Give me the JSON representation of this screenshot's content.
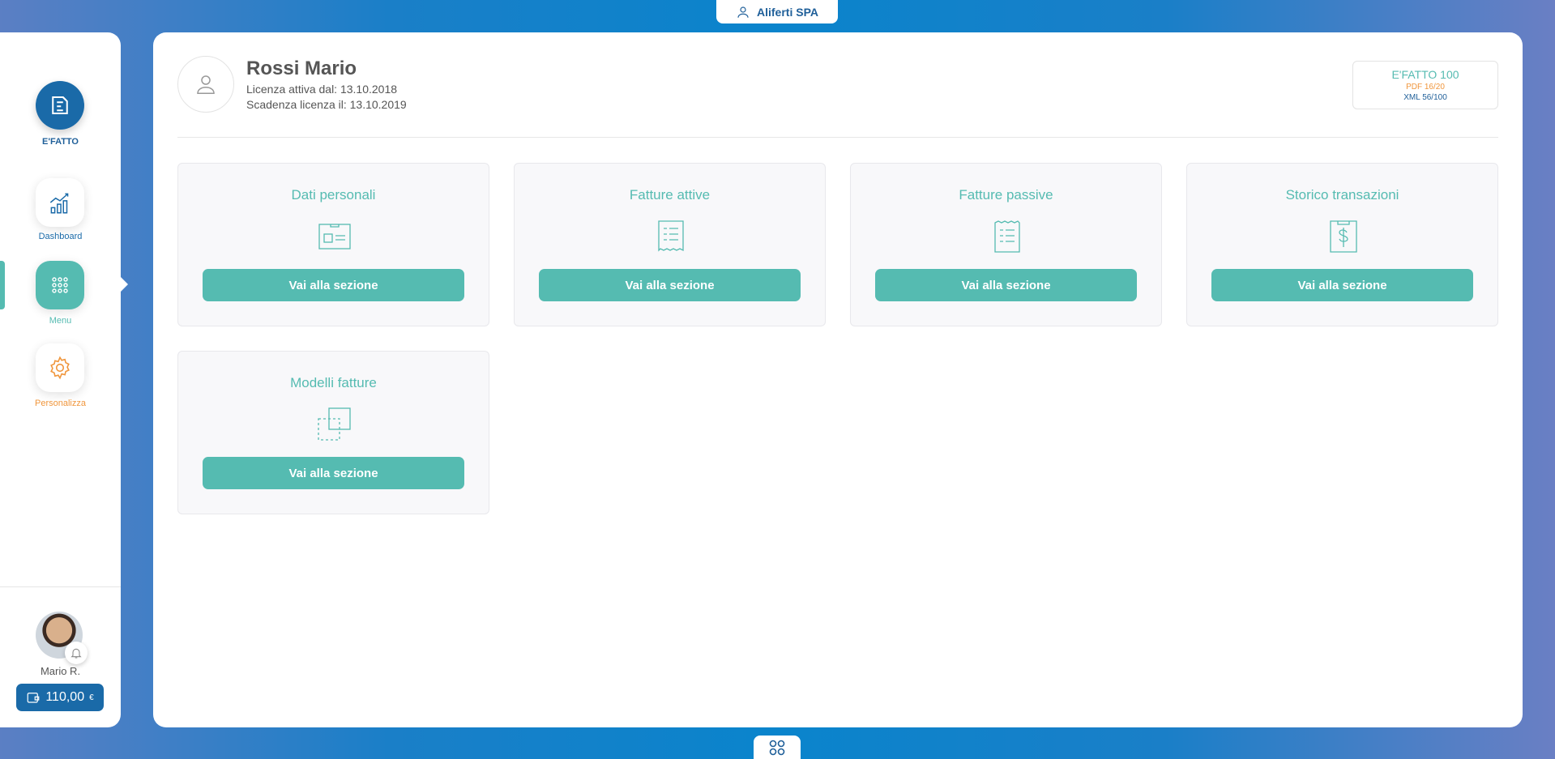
{
  "company": {
    "name": "Aliferti SPA"
  },
  "sidebar": {
    "brand_label": "E'FATTO",
    "items": [
      {
        "label": "Dashboard",
        "icon": "chart-icon",
        "color": "#1a6aa8"
      },
      {
        "label": "Menu",
        "icon": "grid-icon",
        "color": "#55bbb1",
        "active": true
      },
      {
        "label": "Personalizza",
        "icon": "gear-icon",
        "color": "#f0963c"
      }
    ],
    "user_name": "Mario R.",
    "wallet": {
      "amount": "110,00",
      "currency": "€"
    }
  },
  "profile": {
    "name": "Rossi Mario",
    "license_active": "Licenza attiva dal: 13.10.2018",
    "license_expiry": "Scadenza licenza il: 13.10.2019"
  },
  "plan": {
    "title": "E'FATTO 100",
    "pdf": "PDF 16/20",
    "xml": "XML 56/100"
  },
  "cards": [
    {
      "title": "Dati personali",
      "icon": "id-card-icon",
      "button": "Vai alla sezione"
    },
    {
      "title": "Fatture attive",
      "icon": "invoice-icon",
      "button": "Vai alla sezione"
    },
    {
      "title": "Fatture passive",
      "icon": "invoice-icon",
      "button": "Vai alla sezione"
    },
    {
      "title": "Storico transazioni",
      "icon": "receipt-dollar-icon",
      "button": "Vai alla sezione"
    },
    {
      "title": "Modelli fatture",
      "icon": "copy-icon",
      "button": "Vai alla sezione"
    }
  ],
  "colors": {
    "accent": "#55bbb1",
    "primary": "#1a6aa8",
    "warning": "#f0963c"
  }
}
